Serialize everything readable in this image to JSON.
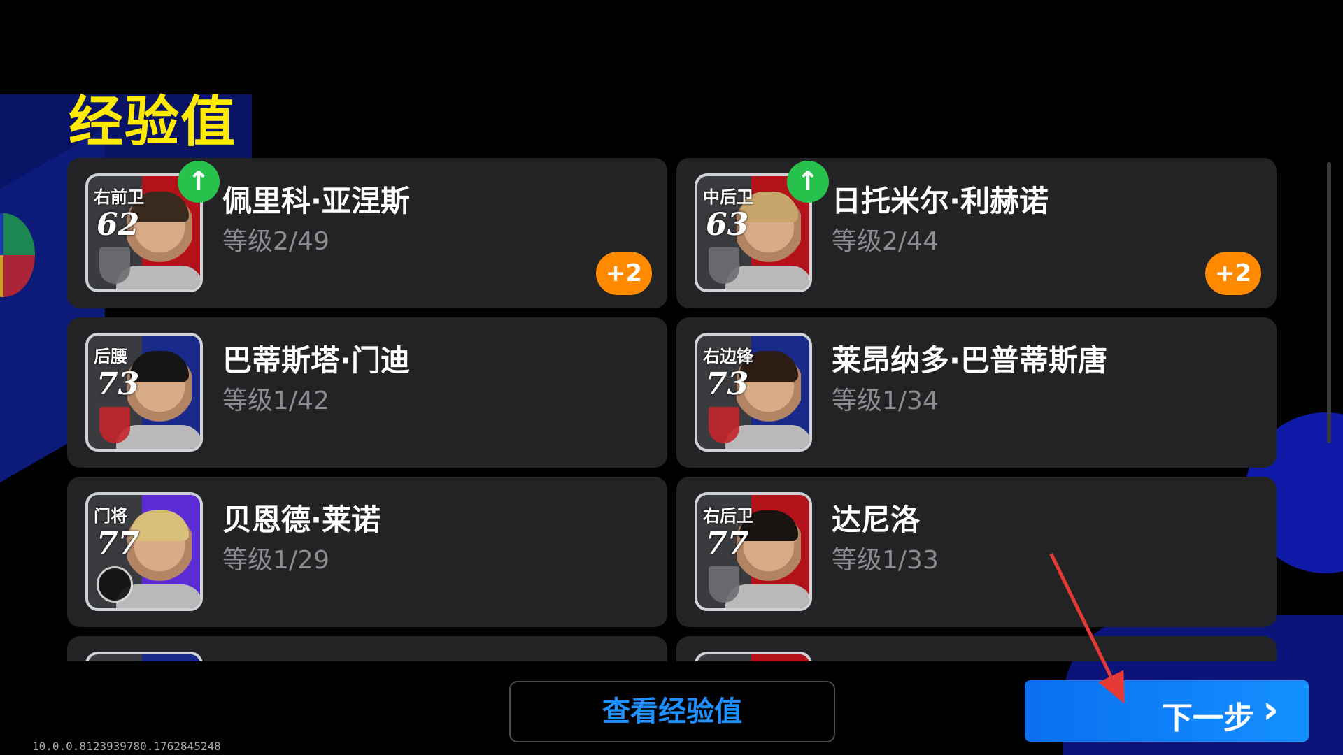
{
  "title": "经验值",
  "players": [
    {
      "position": "右前卫",
      "rating": "62",
      "name": "佩里科·亚涅斯",
      "level": "等级2/49",
      "level_up": true,
      "plus": "+2",
      "stripe": "#b3121b",
      "hair": "#3a2a1e",
      "crest": "grey"
    },
    {
      "position": "中后卫",
      "rating": "63",
      "name": "日托米尔·利赫诺",
      "level": "等级2/44",
      "level_up": true,
      "plus": "+2",
      "stripe": "#b3121b",
      "hair": "#c8a56a",
      "crest": "grey"
    },
    {
      "position": "后腰",
      "rating": "73",
      "name": "巴蒂斯塔·门迪",
      "level": "等级1/42",
      "level_up": false,
      "plus": "",
      "stripe": "#1a2a8a",
      "hair": "#151515",
      "crest": "red"
    },
    {
      "position": "右边锋",
      "rating": "73",
      "name": "莱昂纳多·巴普蒂斯唐",
      "level": "等级1/34",
      "level_up": false,
      "plus": "",
      "stripe": "#1a2a8a",
      "hair": "#2b1d14",
      "crest": "red"
    },
    {
      "position": "门将",
      "rating": "77",
      "name": "贝恩德·莱诺",
      "level": "等级1/29",
      "level_up": false,
      "plus": "",
      "stripe": "#5b2bd6",
      "hair": "#d9c07a",
      "crest": "black"
    },
    {
      "position": "右后卫",
      "rating": "77",
      "name": "达尼洛",
      "level": "等级1/33",
      "level_up": false,
      "plus": "",
      "stripe": "#b3121b",
      "hair": "#1a1410",
      "crest": "grey"
    },
    {
      "position": "",
      "rating": "",
      "name": "",
      "level": "",
      "level_up": false,
      "plus": "",
      "stripe": "#1a2a8a",
      "hair": "#2b1d14",
      "crest": "grey"
    },
    {
      "position": "",
      "rating": "",
      "name": "",
      "level": "",
      "level_up": false,
      "plus": "",
      "stripe": "#b3121b",
      "hair": "#2b1d14",
      "crest": "grey"
    }
  ],
  "buttons": {
    "view_exp": "查看经验值",
    "next": "下一步",
    "next_chevron": "›"
  },
  "up_icon": "↑",
  "version": "10.0.0.8123939780.1762845248"
}
